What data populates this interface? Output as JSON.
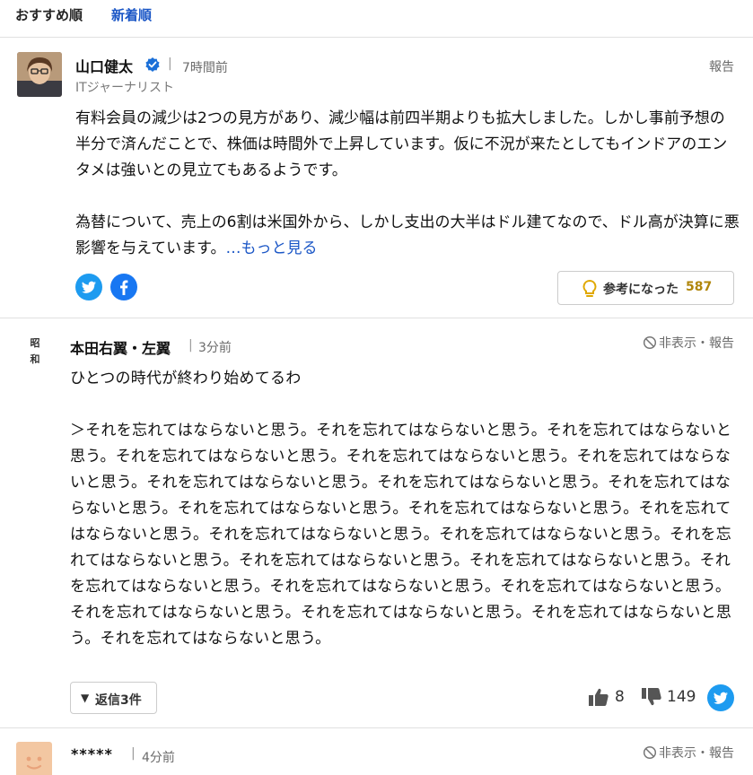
{
  "tabs": {
    "recommended": "おすすめ順",
    "newest": "新着順"
  },
  "comment1": {
    "name": "山口健太",
    "time": "7時間前",
    "role": "ITジャーナリスト",
    "report": "報告",
    "para1": "有料会員の減少は2つの見方があり、減少幅は前四半期よりも拡大しました。しかし事前予想の半分で済んだことで、株価は時間外で上昇しています。仮に不況が来たとしてもインドアのエンタメは強いとの見立てもあるようです。",
    "para2": "為替について、売上の6割は米国外から、しかし支出の大半はドル建てなので、ドル高が決算に悪影響を与えています。",
    "more": "…もっと見る",
    "helpful_label": "参考になった",
    "helpful_count": "587",
    "icons": [
      "verified-icon",
      "twitter-icon",
      "facebook-icon",
      "lightbulb-icon"
    ],
    "colors": {
      "accent": "#1a56c6",
      "twitter": "#1d9bf0",
      "facebook": "#1877f2",
      "helpful_count": "#b0860a"
    }
  },
  "comment2": {
    "avatar_text_1": "昭",
    "avatar_text_2": "和",
    "name": "本田右翼・左翼",
    "time": "3分前",
    "report": "非表示・報告",
    "para1": "ひとつの時代が終わり始めてるわ",
    "para2": "＞それを忘れてはならないと思う。それを忘れてはならないと思う。それを忘れてはならないと思う。それを忘れてはならないと思う。それを忘れてはならないと思う。それを忘れてはならないと思う。それを忘れてはならないと思う。それを忘れてはならないと思う。それを忘れてはならないと思う。それを忘れてはならないと思う。それを忘れてはならないと思う。それを忘れてはならないと思う。それを忘れてはならないと思う。それを忘れてはならないと思う。それを忘れてはならないと思う。それを忘れてはならないと思う。それを忘れてはならないと思う。それを忘れてはならないと思う。それを忘れてはならないと思う。それを忘れてはならないと思う。それを忘れてはならないと思う。それを忘れてはならないと思う。それを忘れてはならないと思う。それを忘れてはならないと思う。",
    "replies": "返信3件",
    "likes": "8",
    "dislikes": "149",
    "icons": [
      "ban-icon",
      "caret-down-icon",
      "thumbs-up-icon",
      "thumbs-down-icon",
      "twitter-icon"
    ]
  },
  "comment3": {
    "name": "*****",
    "time": "4分前",
    "report": "非表示・報告",
    "icons": [
      "smiley-avatar-icon",
      "ban-icon"
    ]
  }
}
